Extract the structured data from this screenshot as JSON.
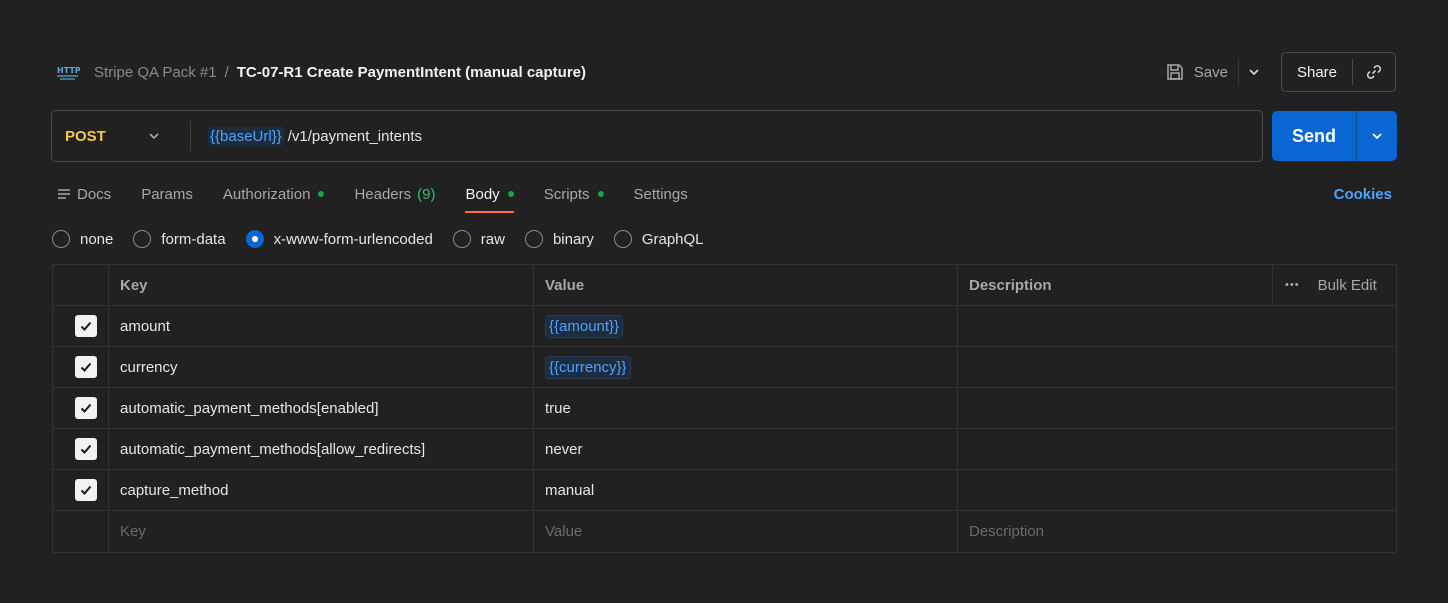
{
  "header": {
    "breadcrumb_parent": "Stripe QA Pack #1",
    "breadcrumb_sep": "/",
    "title": "TC-07-R1 Create PaymentIntent (manual capture)",
    "save_label": "Save",
    "share_label": "Share"
  },
  "request": {
    "method": "POST",
    "url_var": "{{baseUrl}}",
    "url_path": "/v1/payment_intents",
    "send_label": "Send"
  },
  "tabs": [
    {
      "label": "Docs"
    },
    {
      "label": "Params"
    },
    {
      "label": "Authorization",
      "dot": true
    },
    {
      "label": "Headers",
      "count": "(9)"
    },
    {
      "label": "Body",
      "dot": true,
      "active": true
    },
    {
      "label": "Scripts",
      "dot": true
    },
    {
      "label": "Settings"
    }
  ],
  "cookies_label": "Cookies",
  "body_types": [
    {
      "label": "none",
      "checked": false
    },
    {
      "label": "form-data",
      "checked": false
    },
    {
      "label": "x-www-form-urlencoded",
      "checked": true
    },
    {
      "label": "raw",
      "checked": false
    },
    {
      "label": "binary",
      "checked": false
    },
    {
      "label": "GraphQL",
      "checked": false
    }
  ],
  "table": {
    "headers": {
      "key": "Key",
      "value": "Value",
      "description": "Description",
      "bulk_edit": "Bulk Edit"
    },
    "rows": [
      {
        "key": "amount",
        "value": "{{amount}}",
        "is_var": true,
        "checked": true
      },
      {
        "key": "currency",
        "value": "{{currency}}",
        "is_var": true,
        "checked": true
      },
      {
        "key": "automatic_payment_methods[enabled]",
        "value": "true",
        "is_var": false,
        "checked": true
      },
      {
        "key": "automatic_payment_methods[allow_redirects]",
        "value": "never",
        "is_var": false,
        "checked": true
      },
      {
        "key": "capture_method",
        "value": "manual",
        "is_var": false,
        "checked": true
      }
    ],
    "placeholder": {
      "key": "Key",
      "value": "Value",
      "description": "Description"
    }
  },
  "colors": {
    "accent": "#0a66d2",
    "method": "#f0c94c",
    "variable": "#4da3ff",
    "active_tab_underline": "#ff6c37",
    "status_dot": "#16a34a"
  }
}
